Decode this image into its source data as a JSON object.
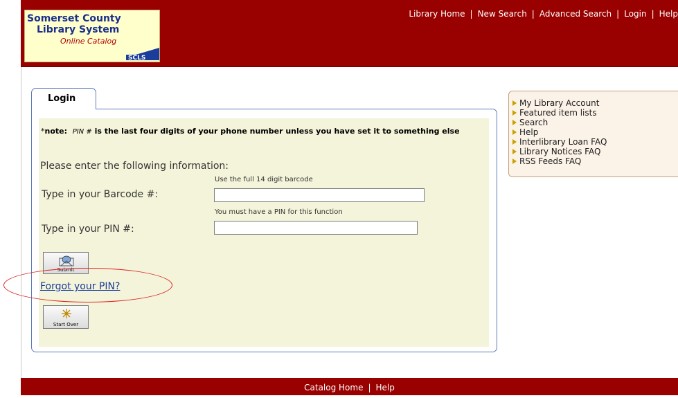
{
  "logo": {
    "line1": "Somerset County",
    "line2": "Library System",
    "line3": "Online Catalog",
    "mark": "SCLS"
  },
  "topnav": {
    "items": [
      "Library Home",
      "New Search",
      "Advanced Search",
      "Login",
      "Help"
    ],
    "separator": "|"
  },
  "tab": {
    "label": "Login"
  },
  "note": {
    "asterisk": "*",
    "prefix": "note:",
    "pin": "PIN #",
    "text": "is the last four digits of your phone number unless you have set it to something else"
  },
  "form": {
    "intro": "Please enter the following information:",
    "barcode_hint": "Use the full 14 digit barcode",
    "barcode_label": "Type in your Barcode #:",
    "barcode_value": "",
    "pin_hint": "You must have a PIN for this function",
    "pin_label": "Type in your PIN #:",
    "pin_value": "",
    "submit_label": "Submit",
    "forgot_link": "Forgot your PIN?",
    "startover_label": "Start Over"
  },
  "sidebar": {
    "items": [
      "My Library Account",
      "Featured item lists",
      "Search",
      "Help",
      "Interlibrary Loan FAQ",
      "Library Notices FAQ",
      "RSS Feeds FAQ"
    ]
  },
  "footer": {
    "items": [
      "Catalog Home",
      "Help"
    ],
    "separator": "|"
  },
  "colors": {
    "header": "#990000",
    "panel_fill": "#f4f4da",
    "link": "#1a3c9a",
    "annotation_circle": "#dd2222"
  }
}
